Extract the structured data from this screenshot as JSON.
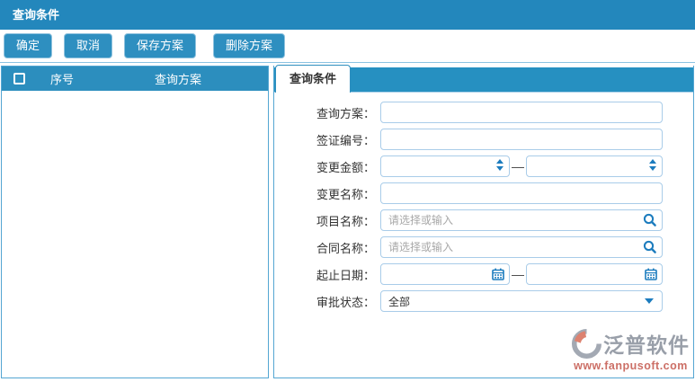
{
  "titlebar": {
    "title": "查询条件"
  },
  "toolbar": {
    "buttons": [
      "确定",
      "取消",
      "保存方案",
      "删除方案"
    ]
  },
  "left_table": {
    "columns": {
      "index": "序号",
      "plan": "查询方案"
    },
    "rows": []
  },
  "right_panel": {
    "tab_label": "查询条件",
    "form": {
      "range_dash": "—",
      "rows": [
        {
          "label": "查询方案：",
          "type": "text",
          "value": ""
        },
        {
          "label": "签证编号：",
          "type": "text",
          "value": ""
        },
        {
          "label": "变更金额：",
          "type": "number-range",
          "value_from": "",
          "value_to": ""
        },
        {
          "label": "变更名称：",
          "type": "text",
          "value": ""
        },
        {
          "label": "项目名称：",
          "type": "search",
          "placeholder": "请选择或输入",
          "value": ""
        },
        {
          "label": "合同名称：",
          "type": "search",
          "placeholder": "请选择或输入",
          "value": ""
        },
        {
          "label": "起止日期：",
          "type": "date-range",
          "value_from": "",
          "value_to": ""
        },
        {
          "label": "审批状态：",
          "type": "select",
          "value": "全部"
        }
      ]
    }
  },
  "watermark": {
    "brand": "泛普软件",
    "url": "www.fanpusoft.com"
  },
  "colors": {
    "titlebar": "#2387BC",
    "button": "#2E8FC0",
    "table_header": "#2C8EBE",
    "tab_strip": "#2690C1",
    "input_border": "#A9CCE9",
    "icon_accent": "#1C7CBE",
    "watermark_gray": "#999FA9",
    "watermark_red": "#CC6F66"
  }
}
